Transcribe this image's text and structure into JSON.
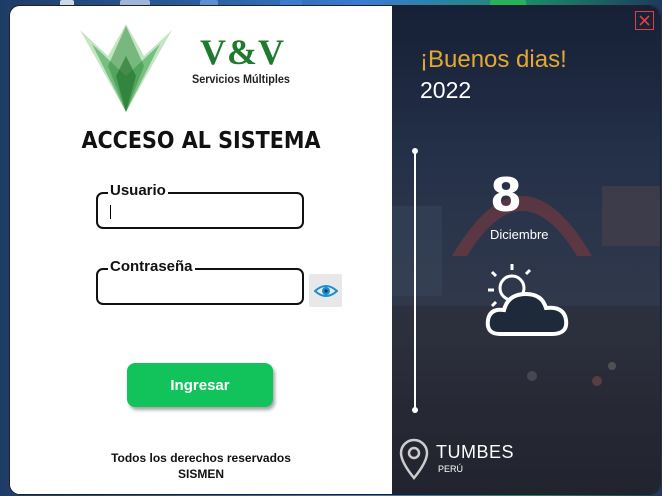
{
  "brand": {
    "name": "V&V",
    "subtitle": "Servicios Múltiples"
  },
  "login": {
    "title": "ACCESO AL SISTEMA",
    "username": {
      "legend": "Usuario",
      "value": "",
      "placeholder": ""
    },
    "password": {
      "legend": "Contraseña",
      "value": "",
      "placeholder": ""
    },
    "show_password_icon": "eye-icon",
    "submit_label": "Ingresar",
    "footer_line1": "Todos los derechos reservados",
    "footer_line2": "SISMEN"
  },
  "info_panel": {
    "greeting": "¡Buenos dias!",
    "year": "2022",
    "day": "8",
    "month": "Diciembre",
    "weather_icon": "partly-sunny-icon",
    "city": "TUMBES",
    "country": "PERÚ",
    "location_icon": "location-pin-icon",
    "close_icon": "close-icon"
  },
  "colors": {
    "brand_green": "#1f7a2e",
    "submit_green": "#11c35a",
    "greeting_gold": "#e3a832",
    "close_red": "#e04040"
  }
}
